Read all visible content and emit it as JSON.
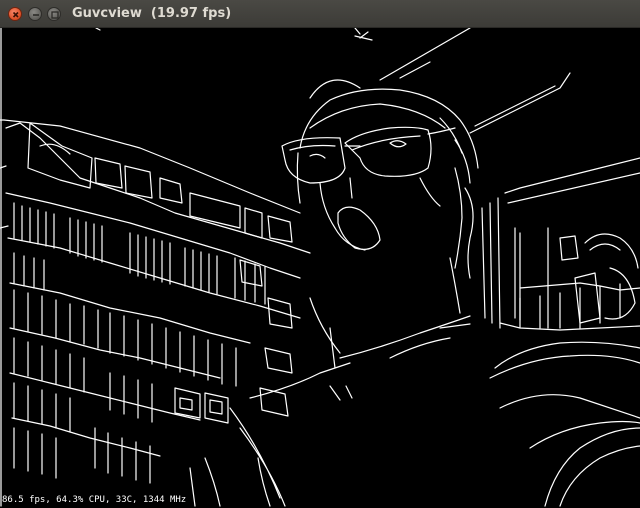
{
  "window": {
    "title": "Guvcview  (19.97 fps)",
    "buttons": {
      "close_icon": "close-icon",
      "minimize_icon": "minimize-icon",
      "maximize_icon": "maximize-icon"
    }
  },
  "video": {
    "status_text": "86.5 fps, 64.3% CPU, 33C, 1344 MHz",
    "edge_color": "#ffffff",
    "background_color": "#000000"
  },
  "colors": {
    "titlebar": "#3c3b37",
    "title_text": "#dfdbd2",
    "close_button": "#e0542b"
  }
}
